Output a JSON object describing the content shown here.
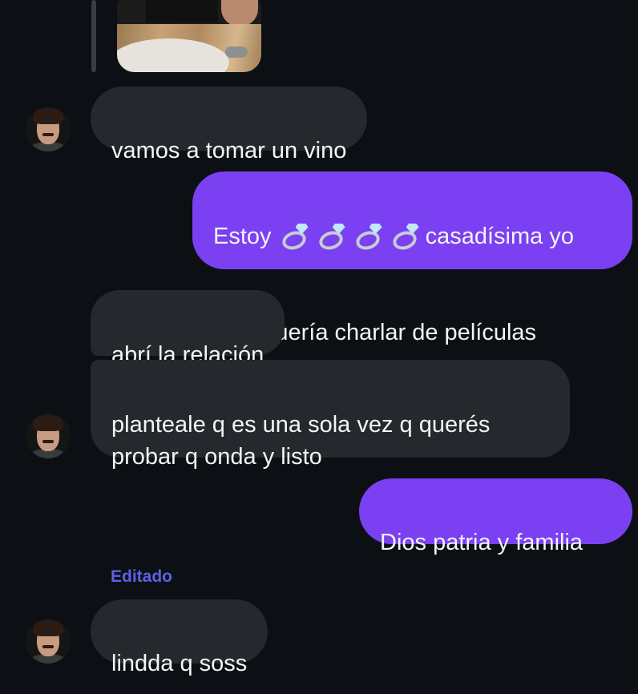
{
  "messages": [
    {
      "id": "m1",
      "direction": "incoming",
      "text": "vamos a tomar un vino"
    },
    {
      "id": "m2",
      "direction": "outgoing",
      "text_before": "Estoy ",
      "emoji": "ring-icon",
      "emoji_count": 4,
      "text_after_line1": "casadísima yo",
      "text_line2": "solo quería charlar de películas"
    },
    {
      "id": "m3",
      "direction": "incoming",
      "text": "abrí la relación"
    },
    {
      "id": "m4",
      "direction": "incoming",
      "text": "planteale q es una sola vez q querés\nprobar q onda y listo"
    },
    {
      "id": "m5",
      "direction": "outgoing",
      "text": "Dios patria y familia"
    },
    {
      "id": "m6",
      "direction": "incoming",
      "label": "Editado",
      "text": "lindda q soss"
    }
  ],
  "colors": {
    "background": "#0c1014",
    "incoming_bubble": "#25292e",
    "outgoing_bubble": "#7a40f2",
    "edited_label": "#5b62e6",
    "text": "#f3f4f6"
  }
}
